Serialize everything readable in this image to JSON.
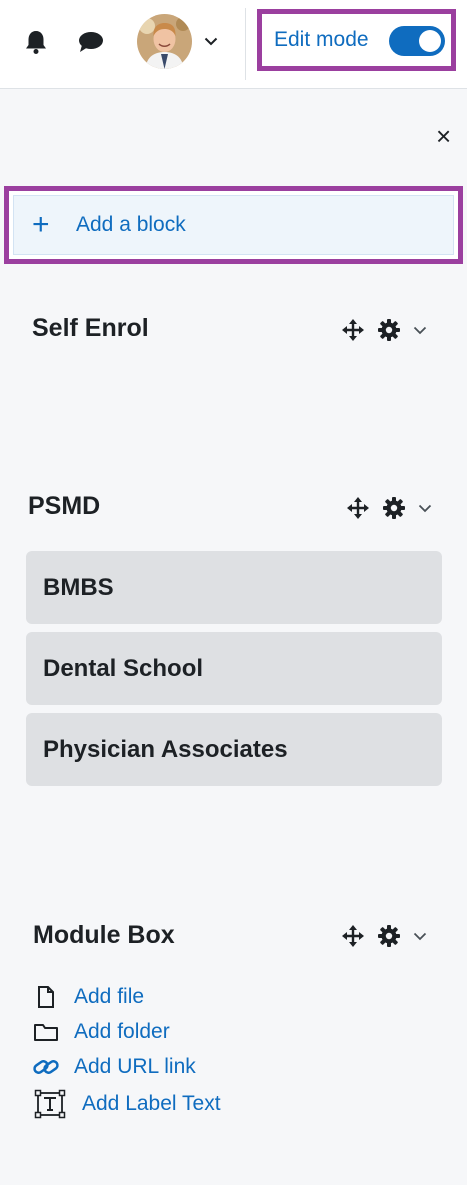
{
  "header": {
    "edit_mode_label": "Edit mode",
    "edit_mode_on": true,
    "icons": [
      "bell-icon",
      "chat-bubble-icon",
      "chevron-down-icon"
    ]
  },
  "drawer": {
    "close_label": "×",
    "add_block": {
      "icon": "+",
      "label": "Add a block"
    }
  },
  "blocks": {
    "self_enrol": {
      "title": "Self Enrol"
    },
    "psmd": {
      "title": "PSMD",
      "links": [
        "BMBS",
        "Dental School",
        "Physician Associates"
      ]
    },
    "module_box": {
      "title": "Module Box",
      "items": [
        {
          "icon": "file-icon",
          "label": "Add file"
        },
        {
          "icon": "folder-icon",
          "label": "Add folder"
        },
        {
          "icon": "link-icon",
          "label": "Add URL link"
        },
        {
          "icon": "text-label-icon",
          "label": "Add Label Text"
        }
      ]
    }
  },
  "colors": {
    "accent": "#0f6cbf",
    "highlight": "#9b3f9f",
    "drawer_bg": "#f6f7f9",
    "button_bg": "#dee0e3"
  }
}
